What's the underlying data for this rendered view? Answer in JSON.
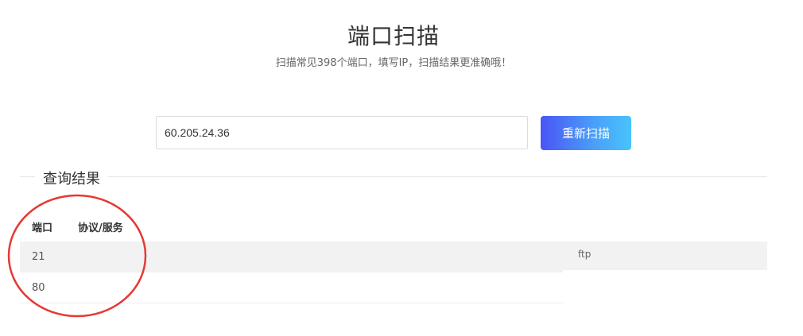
{
  "header": {
    "title": "端口扫描",
    "subtitle": "扫描常见398个端口，填写IP，扫描结果更准确哦！"
  },
  "search": {
    "ip_value": "60.205.24.36",
    "scan_button_label": "重新扫描"
  },
  "results": {
    "section_title": "查询结果",
    "columns": [
      "端口",
      "协议/服务"
    ],
    "rows": [
      {
        "port": "21",
        "service": "ftp"
      },
      {
        "port": "80",
        "service": ""
      }
    ]
  },
  "colors": {
    "button_gradient_start": "#4a55f5",
    "button_gradient_end": "#48c4fb",
    "annotation": "#e53935"
  }
}
